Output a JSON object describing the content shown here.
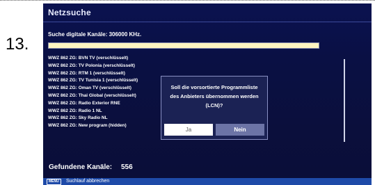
{
  "step_number": "13.",
  "screen": {
    "title": "Netzsuche",
    "search_status": "Suche digitale Kanäle: 306000 KHz.",
    "progress": 1.0,
    "channels": [
      "WWZ 862 ZG: BVN TV (verschlüsselt)",
      "WWZ 862 ZG: TV Polonia (verschlüsselt)",
      "WWZ 862 ZG: RTM 1 (verschlüsselt)",
      "WWZ 862 ZG: TV Tunisia 1 (verschlüsselt)",
      "WWZ 862 ZG: Oman TV (verschlüsselt)",
      "WWZ 862 ZG: Thai Global (verschlüsselt)",
      "WWZ 862 ZG: Radio Exterior RNE",
      "WWZ 862 ZG: Radio 1 NL",
      "WWZ 862 ZG: Sky Radio NL",
      "WWZ 862 ZG: New program (hidden)"
    ],
    "found_label": "Gefundene Kanäle:",
    "found_count": "556"
  },
  "dialog": {
    "line1": "Soll die vorsortierte Programmliste",
    "line2": "des Anbieters übernommen werden",
    "line3": "(LCN)?",
    "yes_label": "Ja",
    "no_label": "Nein"
  },
  "footer": {
    "menu_key": "MENU",
    "cancel_label": "Suchlauf abbrechen"
  },
  "colors": {
    "background": "#0b1250",
    "dialog": "#1b2254",
    "footer": "#1e4aa8",
    "selected_button": "#6c74a6",
    "progress_fill": "#fff5c0"
  }
}
